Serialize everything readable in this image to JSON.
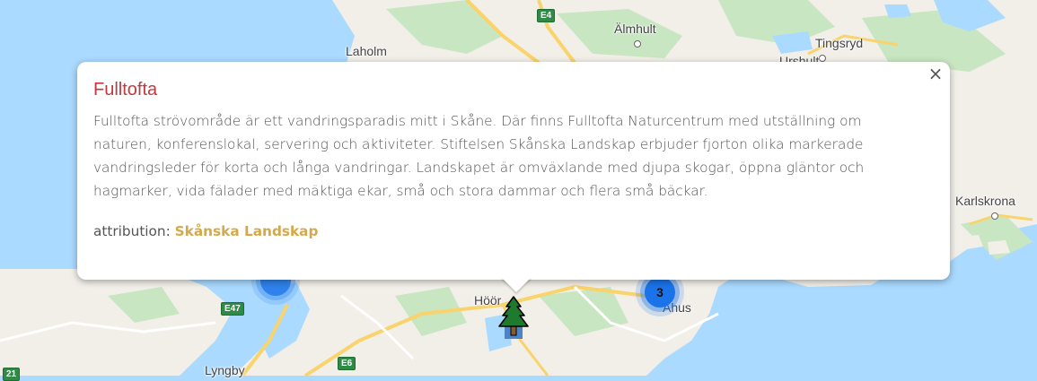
{
  "map": {
    "places": [
      "Laholm",
      "Älmhult",
      "Tingsryd",
      "Urshult",
      "Karlskrona",
      "Höör",
      "Åhus",
      "Lyngby"
    ],
    "roads": [
      "E4",
      "E47",
      "E6",
      "21"
    ],
    "clusters": [
      {
        "count": "3"
      }
    ],
    "marker_icon": "pine-tree-icon",
    "colors": {
      "water": "#aadaff",
      "land": "#f2efe9",
      "forest": "#c8e6c2",
      "road_major": "#f9d36b",
      "road_shield": "#2f8a46",
      "cluster": "#1a73e8"
    }
  },
  "popup": {
    "title": "Fulltofta",
    "description": "Fulltofta strövområde är ett vandringsparadis mitt i Skåne. Där finns Fulltofta Naturcentrum med utställning om naturen, konferenslokal, servering och aktiviteter. Stiftelsen Skånska Landskap erbjuder fjorton olika markerade vandringsleder för korta och långa vandringar. Landskapet är omväxlande med djupa skogar, öppna gläntor och hagmarker, vida fälader med mäktiga ekar, små och stora dammar och flera små bäckar.",
    "attribution_label": "attribution:",
    "attribution_link": "Skånska Landskap",
    "close_symbol": "×",
    "colors": {
      "title": "#c0393f",
      "link": "#d3a94a",
      "text": "#555555"
    }
  }
}
